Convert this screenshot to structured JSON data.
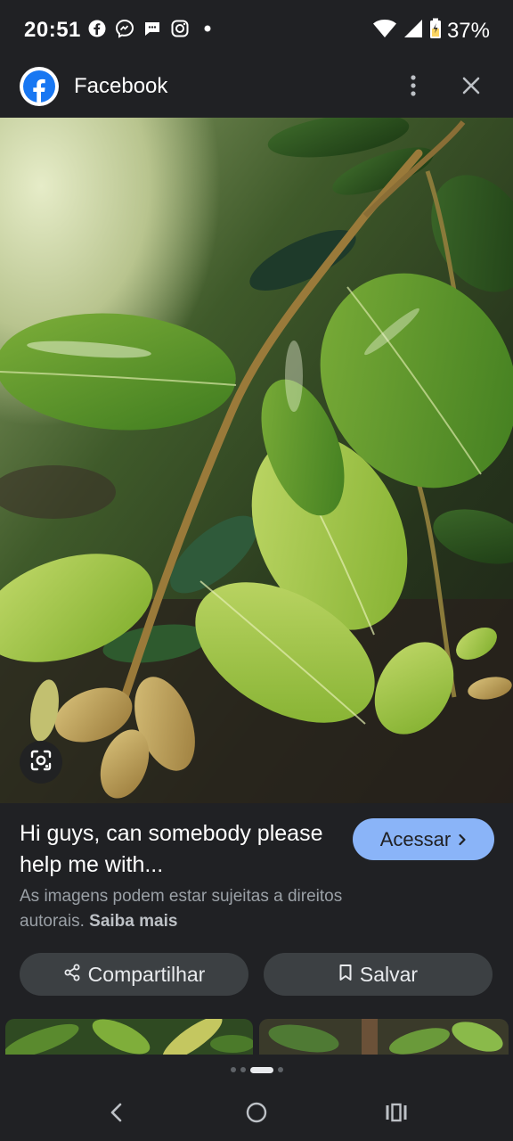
{
  "status_bar": {
    "time": "20:51",
    "battery": "37%"
  },
  "app_bar": {
    "title": "Facebook"
  },
  "result": {
    "title": "Hi guys, can somebody please help me with...",
    "visit_label": "Acessar",
    "copyright_text": "As imagens podem estar sujeitas a direitos autorais.",
    "learn_more": "Saiba mais",
    "share_label": "Compartilhar",
    "save_label": "Salvar"
  },
  "colors": {
    "background": "#202124",
    "accent": "#8ab4f8",
    "facebook_blue": "#1877f2"
  },
  "icons": [
    "facebook-icon",
    "messenger-icon",
    "chat-icon",
    "instagram-icon",
    "wifi-icon",
    "signal-icon",
    "battery-icon",
    "more-vert-icon",
    "close-icon",
    "lens-icon",
    "chevron-right-icon",
    "share-icon",
    "bookmark-icon",
    "back-icon",
    "home-icon",
    "recents-icon"
  ]
}
